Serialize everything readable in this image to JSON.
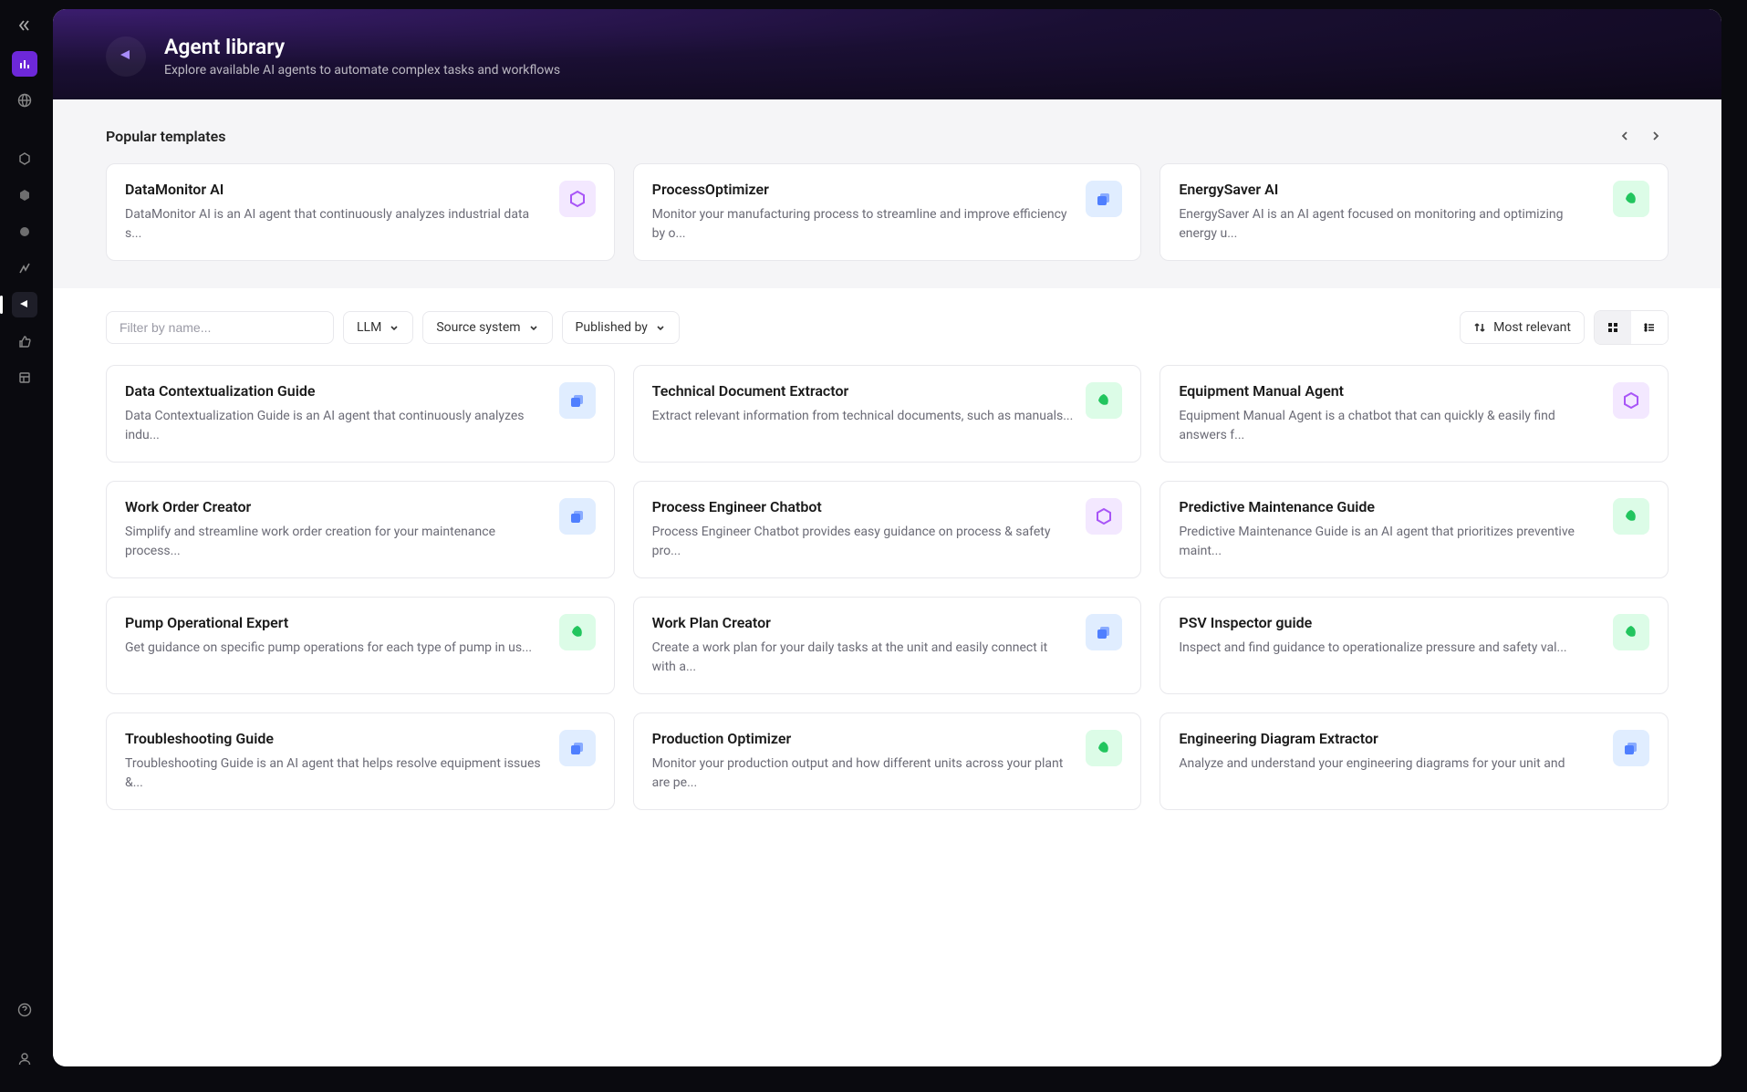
{
  "sidebar": {
    "icons": [
      "chart",
      "globe",
      "hex-outline",
      "cube",
      "circle",
      "lightning",
      "megaphone",
      "thumbs-up",
      "layout"
    ]
  },
  "header": {
    "title": "Agent library",
    "subtitle": "Explore available AI agents to automate complex tasks and workflows"
  },
  "templates": {
    "heading": "Popular templates",
    "items": [
      {
        "title": "DataMonitor AI",
        "desc": "DataMonitor AI is an AI agent that continuously analyzes industrial data s...",
        "icon": "purple"
      },
      {
        "title": "ProcessOptimizer",
        "desc": "Monitor your manufacturing process to streamline and improve efficiency by o...",
        "icon": "blue"
      },
      {
        "title": "EnergySaver AI",
        "desc": "EnergySaver AI is an AI agent focused on monitoring and optimizing energy u...",
        "icon": "green"
      }
    ]
  },
  "filters": {
    "placeholder": "Filter by name...",
    "llm": "LLM",
    "source": "Source system",
    "published": "Published by",
    "sort": "Most relevant"
  },
  "agents": [
    {
      "title": "Data Contextualization Guide",
      "desc": "Data Contextualization Guide is an AI agent that continuously analyzes indu...",
      "icon": "blue"
    },
    {
      "title": "Technical Document Extractor",
      "desc": "Extract relevant information from technical documents, such as manuals...",
      "icon": "green"
    },
    {
      "title": "Equipment Manual Agent",
      "desc": "Equipment Manual Agent is a chatbot that can quickly & easily find answers f...",
      "icon": "purple"
    },
    {
      "title": "Work Order Creator",
      "desc": "Simplify and streamline work order creation for your maintenance process...",
      "icon": "blue"
    },
    {
      "title": "Process Engineer Chatbot",
      "desc": "Process Engineer Chatbot provides easy guidance on process & safety pro...",
      "icon": "purple"
    },
    {
      "title": "Predictive Maintenance Guide",
      "desc": "Predictive Maintenance Guide is an AI agent that prioritizes preventive maint...",
      "icon": "green"
    },
    {
      "title": "Pump Operational Expert",
      "desc": "Get guidance on specific pump operations for each type of pump in us...",
      "icon": "green"
    },
    {
      "title": "Work Plan Creator",
      "desc": "Create a work plan for your daily tasks at the unit and easily connect it with a...",
      "icon": "blue"
    },
    {
      "title": "PSV Inspector guide",
      "desc": "Inspect and find guidance to operationalize pressure and safety val...",
      "icon": "green"
    },
    {
      "title": "Troubleshooting Guide",
      "desc": "Troubleshooting Guide is an AI agent that helps resolve equipment issues &...",
      "icon": "blue"
    },
    {
      "title": "Production Optimizer",
      "desc": "Monitor your production output and how different units across your plant are pe...",
      "icon": "green"
    },
    {
      "title": "Engineering Diagram Extractor",
      "desc": "Analyze and understand your engineering diagrams for your unit and",
      "icon": "blue"
    }
  ]
}
